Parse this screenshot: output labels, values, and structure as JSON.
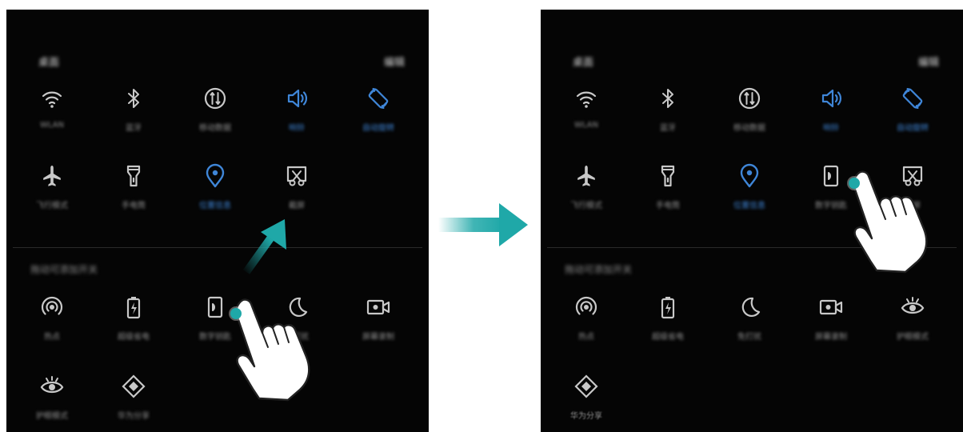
{
  "left_panel": {
    "header_left": "桌面",
    "header_right": "编辑",
    "row1": [
      {
        "icon": "wifi-icon",
        "label": "WLAN",
        "active": false
      },
      {
        "icon": "bluetooth-icon",
        "label": "蓝牙",
        "active": false
      },
      {
        "icon": "mobile-data-icon",
        "label": "移动数据",
        "active": false
      },
      {
        "icon": "sound-icon",
        "label": "响铃",
        "active": true
      },
      {
        "icon": "auto-rotate-icon",
        "label": "自动旋转",
        "active": true
      }
    ],
    "row2": [
      {
        "icon": "airplane-icon",
        "label": "飞行模式",
        "active": false
      },
      {
        "icon": "flashlight-icon",
        "label": "手电筒",
        "active": false
      },
      {
        "icon": "location-icon",
        "label": "位置信息",
        "active": true
      },
      {
        "icon": "screenshot-icon",
        "label": "截屏",
        "active": false
      }
    ],
    "section_title": "拖动可添加开关",
    "row3": [
      {
        "icon": "hotspot-icon",
        "label": "热点",
        "active": false
      },
      {
        "icon": "battery-saver-icon",
        "label": "超级省电",
        "active": false
      },
      {
        "icon": "nfc-icon",
        "label": "数字钥匙",
        "active": false
      },
      {
        "icon": "moon-icon",
        "label": "免打扰",
        "active": false
      },
      {
        "icon": "screen-record-icon",
        "label": "屏幕录制",
        "active": false
      }
    ],
    "row4": [
      {
        "icon": "eye-comfort-icon",
        "label": "护眼模式",
        "active": false
      },
      {
        "icon": "diamond-icon",
        "label": "华为分享",
        "active": false
      }
    ]
  },
  "right_panel": {
    "header_left": "桌面",
    "header_right": "编辑",
    "row1": [
      {
        "icon": "wifi-icon",
        "label": "WLAN",
        "active": false
      },
      {
        "icon": "bluetooth-icon",
        "label": "蓝牙",
        "active": false
      },
      {
        "icon": "mobile-data-icon",
        "label": "移动数据",
        "active": false
      },
      {
        "icon": "sound-icon",
        "label": "响铃",
        "active": true
      },
      {
        "icon": "auto-rotate-icon",
        "label": "自动旋转",
        "active": true
      }
    ],
    "row2": [
      {
        "icon": "airplane-icon",
        "label": "飞行模式",
        "active": false
      },
      {
        "icon": "flashlight-icon",
        "label": "手电筒",
        "active": false
      },
      {
        "icon": "location-icon",
        "label": "位置信息",
        "active": true
      },
      {
        "icon": "nfc-icon",
        "label": "数字钥匙",
        "active": false
      },
      {
        "icon": "screenshot-icon",
        "label": "截屏",
        "active": false
      }
    ],
    "section_title": "拖动可添加开关",
    "row3": [
      {
        "icon": "hotspot-icon",
        "label": "热点",
        "active": false
      },
      {
        "icon": "battery-saver-icon",
        "label": "超级省电",
        "active": false
      },
      {
        "icon": "moon-icon",
        "label": "免打扰",
        "active": false
      },
      {
        "icon": "screen-record-icon",
        "label": "屏幕录制",
        "active": false
      },
      {
        "icon": "eye-comfort-icon",
        "label": "护眼模式",
        "active": false
      }
    ],
    "row4": [
      {
        "icon": "diamond-icon",
        "label": "华为分享",
        "active": false
      }
    ]
  },
  "colors": {
    "active": "#3f86d8",
    "inactive": "#c8c8c8",
    "accent_teal": "#1fa8a8",
    "panel_bg": "#050505"
  }
}
